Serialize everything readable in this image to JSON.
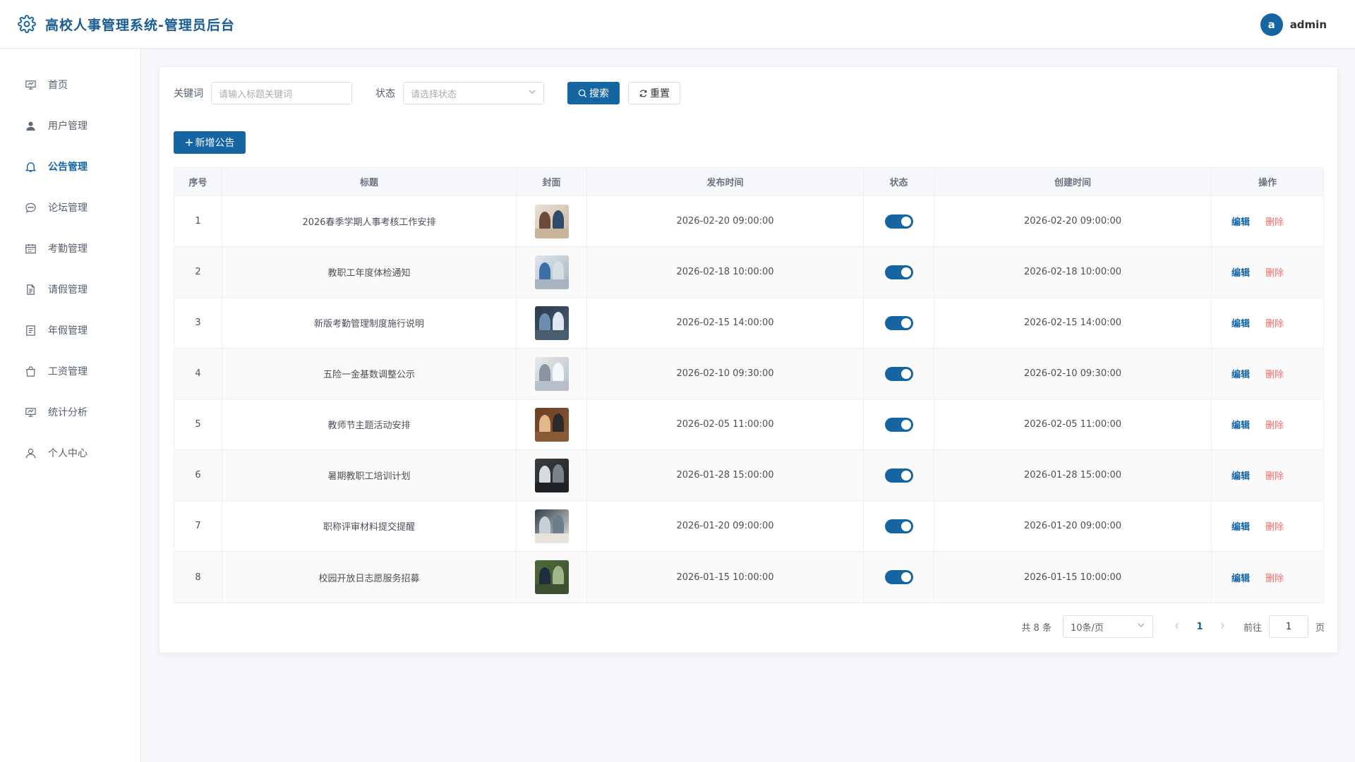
{
  "header": {
    "title": "高校人事管理系统-管理员后台",
    "avatar_letter": "a",
    "username": "admin"
  },
  "sidebar": {
    "items": [
      {
        "label": "首页",
        "icon": "dashboard-icon"
      },
      {
        "label": "用户管理",
        "icon": "user-icon"
      },
      {
        "label": "公告管理",
        "icon": "bell-icon",
        "active": true
      },
      {
        "label": "论坛管理",
        "icon": "chat-icon"
      },
      {
        "label": "考勤管理",
        "icon": "calendar-icon"
      },
      {
        "label": "请假管理",
        "icon": "document-icon"
      },
      {
        "label": "年假管理",
        "icon": "list-icon"
      },
      {
        "label": "工资管理",
        "icon": "bag-icon"
      },
      {
        "label": "统计分析",
        "icon": "chart-icon"
      },
      {
        "label": "个人中心",
        "icon": "person-icon"
      }
    ]
  },
  "filters": {
    "keyword_label": "关键词",
    "keyword_placeholder": "请输入标题关键词",
    "status_label": "状态",
    "status_placeholder": "请选择状态",
    "search_label": "搜索",
    "reset_label": "重置"
  },
  "toolbar": {
    "add_label": "新增公告"
  },
  "table": {
    "headers": [
      "序号",
      "标题",
      "封面",
      "发布时间",
      "状态",
      "创建时间",
      "操作"
    ],
    "edit_label": "编辑",
    "delete_label": "删除",
    "rows": [
      {
        "index": "1",
        "title": "2026春季学期人事考核工作安排",
        "publish_time": "2026-02-20 09:00:00",
        "status": true,
        "created_time": "2026-02-20 09:00:00"
      },
      {
        "index": "2",
        "title": "教职工年度体检通知",
        "publish_time": "2026-02-18 10:00:00",
        "status": true,
        "created_time": "2026-02-18 10:00:00"
      },
      {
        "index": "3",
        "title": "新版考勤管理制度施行说明",
        "publish_time": "2026-02-15 14:00:00",
        "status": true,
        "created_time": "2026-02-15 14:00:00"
      },
      {
        "index": "4",
        "title": "五险一金基数调整公示",
        "publish_time": "2026-02-10 09:30:00",
        "status": true,
        "created_time": "2026-02-10 09:30:00"
      },
      {
        "index": "5",
        "title": "教师节主题活动安排",
        "publish_time": "2026-02-05 11:00:00",
        "status": true,
        "created_time": "2026-02-05 11:00:00"
      },
      {
        "index": "6",
        "title": "暑期教职工培训计划",
        "publish_time": "2026-01-28 15:00:00",
        "status": true,
        "created_time": "2026-01-28 15:00:00"
      },
      {
        "index": "7",
        "title": "职称评审材料提交提醒",
        "publish_time": "2026-01-20 09:00:00",
        "status": true,
        "created_time": "2026-01-20 09:00:00"
      },
      {
        "index": "8",
        "title": "校园开放日志愿服务招募",
        "publish_time": "2026-01-15 10:00:00",
        "status": true,
        "created_time": "2026-01-15 10:00:00"
      }
    ]
  },
  "pagination": {
    "total_text": "共 8 条",
    "page_size": "10条/页",
    "current_page": "1",
    "goto_label": "前往",
    "goto_value": "1",
    "page_suffix": "页"
  },
  "colors": {
    "primary": "#1565a3",
    "danger": "#f56c6c"
  }
}
